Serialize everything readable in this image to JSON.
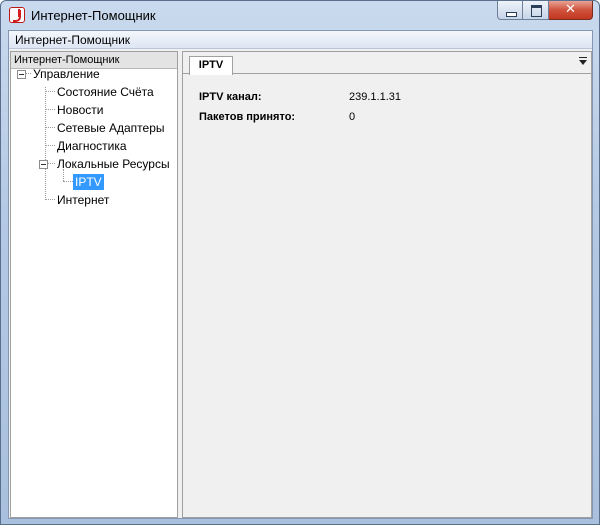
{
  "window": {
    "title": "Интернет-Помощник",
    "icon": "app-logo-icon",
    "close_glyph": "✕"
  },
  "menubar": {
    "items": [
      "Интернет-Помощник"
    ]
  },
  "left_pane": {
    "header": "Интернет-Помощник",
    "tree": {
      "root": "Управление",
      "children": [
        "Состояние Счёта",
        "Новости",
        "Сетевые Адаптеры",
        "Диагностика",
        "Локальные Ресурсы",
        "Интернет"
      ],
      "local_children": [
        "IPTV"
      ],
      "selected": "IPTV"
    }
  },
  "right_pane": {
    "tabs": [
      {
        "label": "IPTV",
        "active": true
      }
    ],
    "fields": [
      {
        "label": "IPTV канал:",
        "value": "239.1.1.31"
      },
      {
        "label": "Пакетов принято:",
        "value": "0"
      }
    ]
  },
  "colors": {
    "selection": "#3399ff",
    "close_button": "#c2361f"
  }
}
